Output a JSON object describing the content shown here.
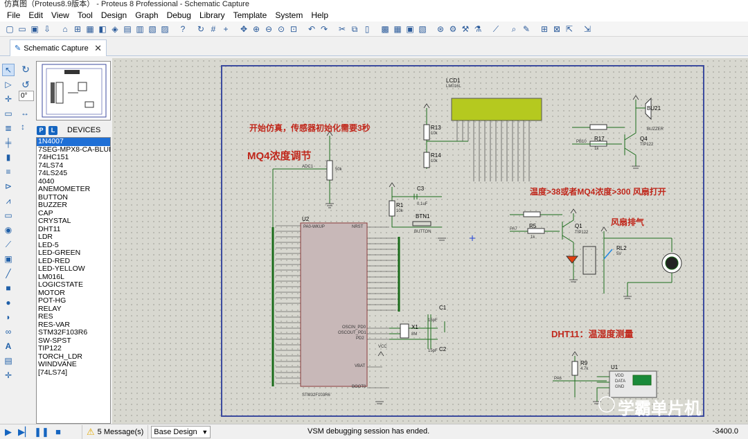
{
  "window": {
    "title": "仿真图（Proteus8.9版本） - Proteus 8 Professional - Schematic Capture"
  },
  "menu": [
    "File",
    "Edit",
    "View",
    "Tool",
    "Design",
    "Graph",
    "Debug",
    "Library",
    "Template",
    "System",
    "Help"
  ],
  "tab": {
    "label": "Schematic Capture",
    "close": "✕"
  },
  "sidebar": {
    "angle": "0°",
    "p_label": "P",
    "l_label": "L",
    "devices_header": "DEVICES",
    "devices": [
      "1N4007",
      "7SEG-MPX8-CA-BLUE",
      "74HC151",
      "74LS74",
      "74LS245",
      "4040",
      "ANEMOMETER",
      "BUTTON",
      "BUZZER",
      "CAP",
      "CRYSTAL",
      "DHT11",
      "LDR",
      "LED-5",
      "LED-GREEN",
      "LED-RED",
      "LED-YELLOW",
      "LM016L",
      "LOGICSTATE",
      "MOTOR",
      "POT-HG",
      "RELAY",
      "RES",
      "RES-VAR",
      "STM32F103R6",
      "SW-SPST",
      "TIP122",
      "TORCH_LDR",
      "WINDVANE",
      "[74LS74]"
    ],
    "selected_index": 0
  },
  "schematic": {
    "note_start": "开始仿真，传感器初始化需要3秒",
    "note_mq4": "MQ4浓度调节",
    "note_fan": "温度>38或者MQ4浓度>300  风扇打开",
    "note_exhaust": "风扇排气",
    "note_dht": "DHT11：温湿度测量",
    "watermark": "学霸单片机",
    "parts": {
      "lcd": {
        "ref": "LCD1",
        "type": "LM016L"
      },
      "r13": {
        "ref": "R13",
        "val": "10k"
      },
      "r14": {
        "ref": "R14",
        "val": "10k"
      },
      "bu21": {
        "ref": "BU21",
        "type": "BUZZER"
      },
      "r17": {
        "ref": "R17",
        "val": "1k",
        "net": "PB10"
      },
      "q4": {
        "ref": "Q4",
        "type": "TIP122"
      },
      "adc": {
        "net": "ADC1",
        "val": "50k"
      },
      "c3": {
        "ref": "C3",
        "val": "0.1uF"
      },
      "r1": {
        "ref": "R1",
        "val": "10k"
      },
      "btn1": {
        "ref": "BTN1",
        "type": "BUTTON"
      },
      "u2": {
        "ref": "U2",
        "type": "STM32F103R6",
        "pin_left": "PA0-WKUP",
        "pin_right": "NRST",
        "vbat": "VBAT",
        "boot": "BOOT0",
        "osc_in": "OSCIN_PD0",
        "osc_out": "OSCOUT_PD1",
        "pd2": "PD2",
        "vcc": "VCC"
      },
      "c1": {
        "ref": "C1",
        "val": "15pF"
      },
      "c2": {
        "ref": "C2",
        "val": "15pF"
      },
      "x1": {
        "ref": "X1",
        "val": "8M"
      },
      "r5": {
        "ref": "R5",
        "val": "1k",
        "net": "PA7"
      },
      "q1": {
        "ref": "Q1",
        "type": "TIP122"
      },
      "rl2": {
        "ref": "RL2",
        "val": "5V"
      },
      "r9": {
        "ref": "R9",
        "val": "4.7k",
        "net": "PA6"
      },
      "u1": {
        "ref": "U1",
        "pins": [
          "VDD",
          "DATA",
          "GND"
        ]
      }
    }
  },
  "status": {
    "messages": "5 Message(s)",
    "design": "Base Design",
    "message_text": "VSM debugging session has ended.",
    "coord": "-3400.0"
  }
}
